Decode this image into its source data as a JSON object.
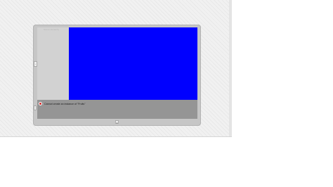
{
  "panel": {
    "header_label": "Scene Hierarchy"
  },
  "console": {
    "error_message": "Cannot create an instance of \"Fruits\"",
    "error_icon": "error-icon"
  },
  "icons": {
    "left_handle": "chevron-left-icon",
    "bottom_handle": "chevron-down-icon"
  },
  "colors": {
    "viewport": "#0000ff",
    "error": "#d62828"
  }
}
